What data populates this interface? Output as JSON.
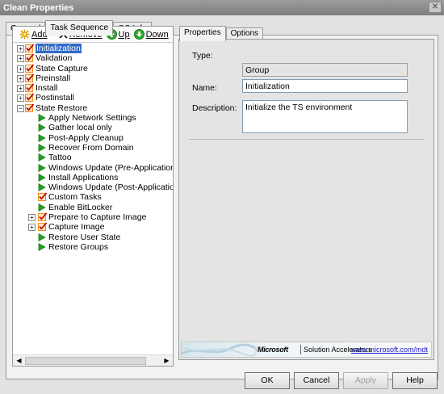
{
  "window": {
    "title": "Clean Properties",
    "close_glyph": "✕"
  },
  "top_tabs": [
    {
      "label": "General",
      "active": false
    },
    {
      "label": "Task Sequence",
      "active": true
    },
    {
      "label": "OS Info",
      "active": false
    }
  ],
  "toolbar": {
    "add_label": "Add",
    "remove_label": "Remove",
    "up_label": "Up",
    "down_label": "Down"
  },
  "tree": [
    {
      "label": "Initialization",
      "type": "group",
      "level": 0,
      "expander": "+",
      "selected": true
    },
    {
      "label": "Validation",
      "type": "group",
      "level": 0,
      "expander": "+"
    },
    {
      "label": "State Capture",
      "type": "group",
      "level": 0,
      "expander": "+"
    },
    {
      "label": "Preinstall",
      "type": "group",
      "level": 0,
      "expander": "+"
    },
    {
      "label": "Install",
      "type": "group",
      "level": 0,
      "expander": "+"
    },
    {
      "label": "Postinstall",
      "type": "group",
      "level": 0,
      "expander": "+"
    },
    {
      "label": "State Restore",
      "type": "group",
      "level": 0,
      "expander": "−"
    },
    {
      "label": "Apply Network Settings",
      "type": "step",
      "level": 1
    },
    {
      "label": "Gather local only",
      "type": "step",
      "level": 1
    },
    {
      "label": "Post-Apply Cleanup",
      "type": "step",
      "level": 1
    },
    {
      "label": "Recover From Domain",
      "type": "step",
      "level": 1
    },
    {
      "label": "Tattoo",
      "type": "step",
      "level": 1
    },
    {
      "label": "Windows Update (Pre-Application Installa",
      "type": "step",
      "level": 1
    },
    {
      "label": "Install Applications",
      "type": "step",
      "level": 1
    },
    {
      "label": "Windows Update (Post-Application Installa",
      "type": "step",
      "level": 1
    },
    {
      "label": "Custom Tasks",
      "type": "group",
      "level": 1
    },
    {
      "label": "Enable BitLocker",
      "type": "step",
      "level": 1
    },
    {
      "label": "Prepare to Capture Image",
      "type": "group",
      "level": 1,
      "expander": "+"
    },
    {
      "label": "Capture Image",
      "type": "group",
      "level": 1,
      "expander": "+"
    },
    {
      "label": "Restore User State",
      "type": "step",
      "level": 1
    },
    {
      "label": "Restore Groups",
      "type": "step",
      "level": 1
    }
  ],
  "right_tabs": [
    {
      "label": "Properties",
      "active": true
    },
    {
      "label": "Options",
      "active": false
    }
  ],
  "properties": {
    "type_label": "Type:",
    "type_value": "Group",
    "name_label": "Name:",
    "name_value": "Initialization",
    "description_label": "Description:",
    "description_value": "Initialize the TS environment"
  },
  "banner": {
    "brand": "Microsoft",
    "tagline": "Solution Accelerators",
    "link": "www.microsoft.com/mdt"
  },
  "buttons": {
    "ok": "OK",
    "cancel": "Cancel",
    "apply": "Apply",
    "help": "Help"
  },
  "colors": {
    "selection": "#3169c6",
    "play_green": "#1fa01f",
    "check_orange": "#f08a1c",
    "link": "#1c1cd0"
  }
}
